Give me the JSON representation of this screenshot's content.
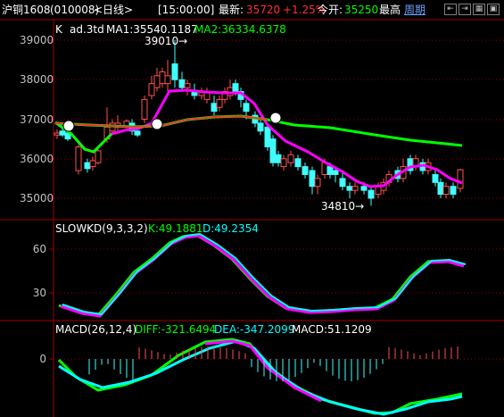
{
  "topbar": {
    "symbol": "沪铜1608",
    "code": "(010008)",
    "period": "<日线>",
    "time": "[15:00:00]",
    "latest_label": "最新:",
    "latest_value": "35720",
    "change_pct": "+1.25%",
    "open_label": "今开:",
    "open_value": "35250",
    "high_label": "最高",
    "cycle_link": "周期",
    "buttons": [
      "⇤",
      "⇥",
      "▦",
      "▣"
    ]
  },
  "main_panel": {
    "name": "K",
    "indicator": "ad.3td",
    "ma1_label": "MA1:35540.1187",
    "ma2_label": "MA2:36334.6378",
    "high_annotation": "39010→",
    "low_annotation": "34810→",
    "y_ticks": [
      "39000",
      "38000",
      "37000",
      "36000",
      "35000"
    ]
  },
  "kd_panel": {
    "name": "SLOWKD(9,3,3,2)",
    "k_label": "K:49.1881",
    "d_label": "D:49.2354",
    "y_ticks": [
      "60",
      "30"
    ]
  },
  "macd_panel": {
    "name": "MACD(26,12,4)",
    "diff_label": "DIFF:-321.6494",
    "dea_label": "DEA:-347.2099",
    "macd_label": "MACD:51.1209",
    "y_ticks": [
      "0"
    ]
  },
  "colors": {
    "background": "#000000",
    "grid_red": "#800000",
    "up_candle": "#ff5050",
    "down_candle": "#40ffff",
    "ma1": "#ffffff",
    "ma2": "#00ff00",
    "k_line": "#ff00ff",
    "d_line": "#00ffff",
    "macd_pos": "#ff5050",
    "macd_neg": "#40ffff"
  }
}
